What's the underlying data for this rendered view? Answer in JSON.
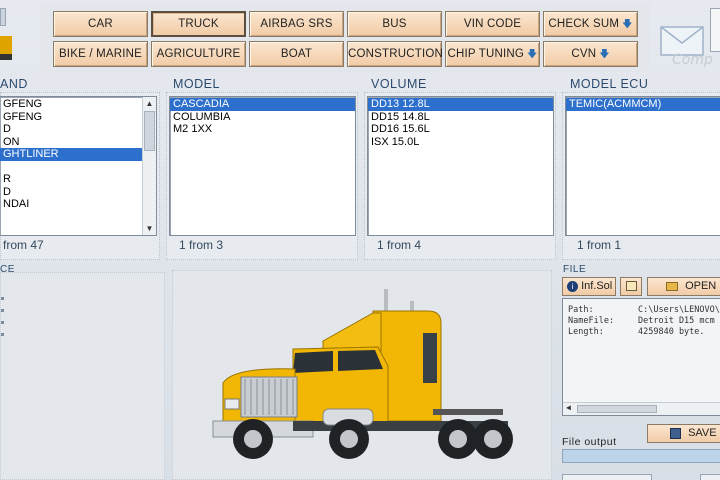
{
  "categories": {
    "row1": [
      {
        "label": "CAR",
        "arrow": false
      },
      {
        "label": "TRUCK",
        "arrow": false,
        "active": true
      },
      {
        "label": "AIRBAG SRS",
        "arrow": false
      },
      {
        "label": "BUS",
        "arrow": false
      },
      {
        "label": "VIN CODE",
        "arrow": false
      },
      {
        "label": "CHECK SUM",
        "arrow": true
      }
    ],
    "row2": [
      {
        "label": "BIKE / MARINE",
        "arrow": false
      },
      {
        "label": "AGRICULTURE",
        "arrow": false
      },
      {
        "label": "BOAT",
        "arrow": false
      },
      {
        "label": "CONSTRUCTION",
        "arrow": false
      },
      {
        "label": "CHIP TUNING",
        "arrow": true
      },
      {
        "label": "CVN",
        "arrow": true
      }
    ],
    "arrow_glyph": "🡇"
  },
  "brand": {
    "label": "AND",
    "items": [
      "GFENG",
      "GFENG",
      "D",
      "ON",
      "GHTLINER",
      "",
      "R",
      "D",
      "NDAI"
    ],
    "selected_index": 4,
    "count": "from 47"
  },
  "model": {
    "label": "MODEL",
    "items": [
      "CASCADIA",
      "COLUMBIA",
      "M2 1XX"
    ],
    "selected_index": 0,
    "count": "1 from 3"
  },
  "volume": {
    "label": "VOLUME",
    "items": [
      "DD13 12.8L",
      "DD15 14.8L",
      "DD16 15.6L",
      "ISX 15.0L"
    ],
    "selected_index": 0,
    "count": "1 from 4"
  },
  "ecu": {
    "label": "MODEL ECU",
    "items": [
      "TEMIC(ACMMCM)"
    ],
    "selected_index": 0,
    "count": "1 from 1"
  },
  "left_section": {
    "label": "CE"
  },
  "file": {
    "label": "FILE",
    "info_button": "Inf.Sol",
    "open_button": "OPEN F",
    "rows": [
      {
        "key": "Path:",
        "value": "C:\\Users\\LENOVO\\"
      },
      {
        "key": "NameFile:",
        "value": "Detroit D15 mcm"
      },
      {
        "key": "Length:",
        "value": "4259840 byte."
      }
    ],
    "output_label": "File output",
    "save_button": "SAVE F"
  },
  "watermark": "Comp",
  "colors": {
    "button_bg": "#f1cba6",
    "selection": "#2c6fcc",
    "section_text": "#2c4a6e",
    "truck_body": "#f2b705"
  }
}
